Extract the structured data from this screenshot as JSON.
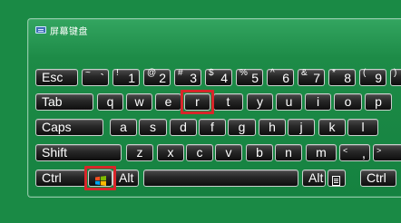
{
  "window": {
    "title": "屏幕键盘"
  },
  "keyboard": {
    "row_number": [
      {
        "name": "key-esc",
        "label": "Esc"
      },
      {
        "name": "key-backtick",
        "sub": "~",
        "label": "`"
      },
      {
        "name": "key-1",
        "sub": "!",
        "label": "1"
      },
      {
        "name": "key-2",
        "sub": "@",
        "label": "2"
      },
      {
        "name": "key-3",
        "sub": "#",
        "label": "3"
      },
      {
        "name": "key-4",
        "sub": "$",
        "label": "4"
      },
      {
        "name": "key-5",
        "sub": "%",
        "label": "5"
      },
      {
        "name": "key-6",
        "sub": "^",
        "label": "6"
      },
      {
        "name": "key-7",
        "sub": "&",
        "label": "7"
      },
      {
        "name": "key-8",
        "sub": "*",
        "label": "8"
      },
      {
        "name": "key-9",
        "sub": "(",
        "label": "9"
      },
      {
        "name": "key-0",
        "sub": ")",
        "label": ""
      }
    ],
    "row_top": [
      {
        "name": "key-tab",
        "label": "Tab"
      },
      {
        "name": "key-q",
        "label": "q"
      },
      {
        "name": "key-w",
        "label": "w"
      },
      {
        "name": "key-e",
        "label": "e"
      },
      {
        "name": "key-r",
        "label": "r"
      },
      {
        "name": "key-t",
        "label": "t"
      },
      {
        "name": "key-y",
        "label": "y"
      },
      {
        "name": "key-u",
        "label": "u"
      },
      {
        "name": "key-i",
        "label": "i"
      },
      {
        "name": "key-o",
        "label": "o"
      },
      {
        "name": "key-p",
        "label": "p"
      }
    ],
    "row_home": [
      {
        "name": "key-caps",
        "label": "Caps"
      },
      {
        "name": "key-a",
        "label": "a"
      },
      {
        "name": "key-s",
        "label": "s"
      },
      {
        "name": "key-d",
        "label": "d"
      },
      {
        "name": "key-f",
        "label": "f"
      },
      {
        "name": "key-g",
        "label": "g"
      },
      {
        "name": "key-h",
        "label": "h"
      },
      {
        "name": "key-j",
        "label": "j"
      },
      {
        "name": "key-k",
        "label": "k"
      },
      {
        "name": "key-l",
        "label": "l"
      }
    ],
    "row_bottom": [
      {
        "name": "key-shift",
        "label": "Shift"
      },
      {
        "name": "key-z",
        "label": "z"
      },
      {
        "name": "key-x",
        "label": "x"
      },
      {
        "name": "key-c",
        "label": "c"
      },
      {
        "name": "key-v",
        "label": "v"
      },
      {
        "name": "key-b",
        "label": "b"
      },
      {
        "name": "key-n",
        "label": "n"
      },
      {
        "name": "key-m",
        "label": "m"
      },
      {
        "name": "key-comma",
        "sub": "<",
        "label": ","
      },
      {
        "name": "key-period",
        "sub": ">",
        "label": ""
      }
    ],
    "row_space": [
      {
        "name": "key-ctrl-left",
        "label": "Ctrl"
      },
      {
        "name": "key-windows",
        "icon": "windows-logo-icon",
        "label": ""
      },
      {
        "name": "key-alt-left",
        "label": "Alt"
      },
      {
        "name": "key-space",
        "label": ""
      },
      {
        "name": "key-alt-right",
        "label": "Alt"
      },
      {
        "name": "key-menu",
        "icon": "context-menu-icon",
        "label": ""
      },
      {
        "name": "key-ctrl-right",
        "label": "Ctrl"
      }
    ],
    "highlighted_keys": [
      "key-r",
      "key-windows"
    ],
    "highlight_color": "#d8262a"
  }
}
